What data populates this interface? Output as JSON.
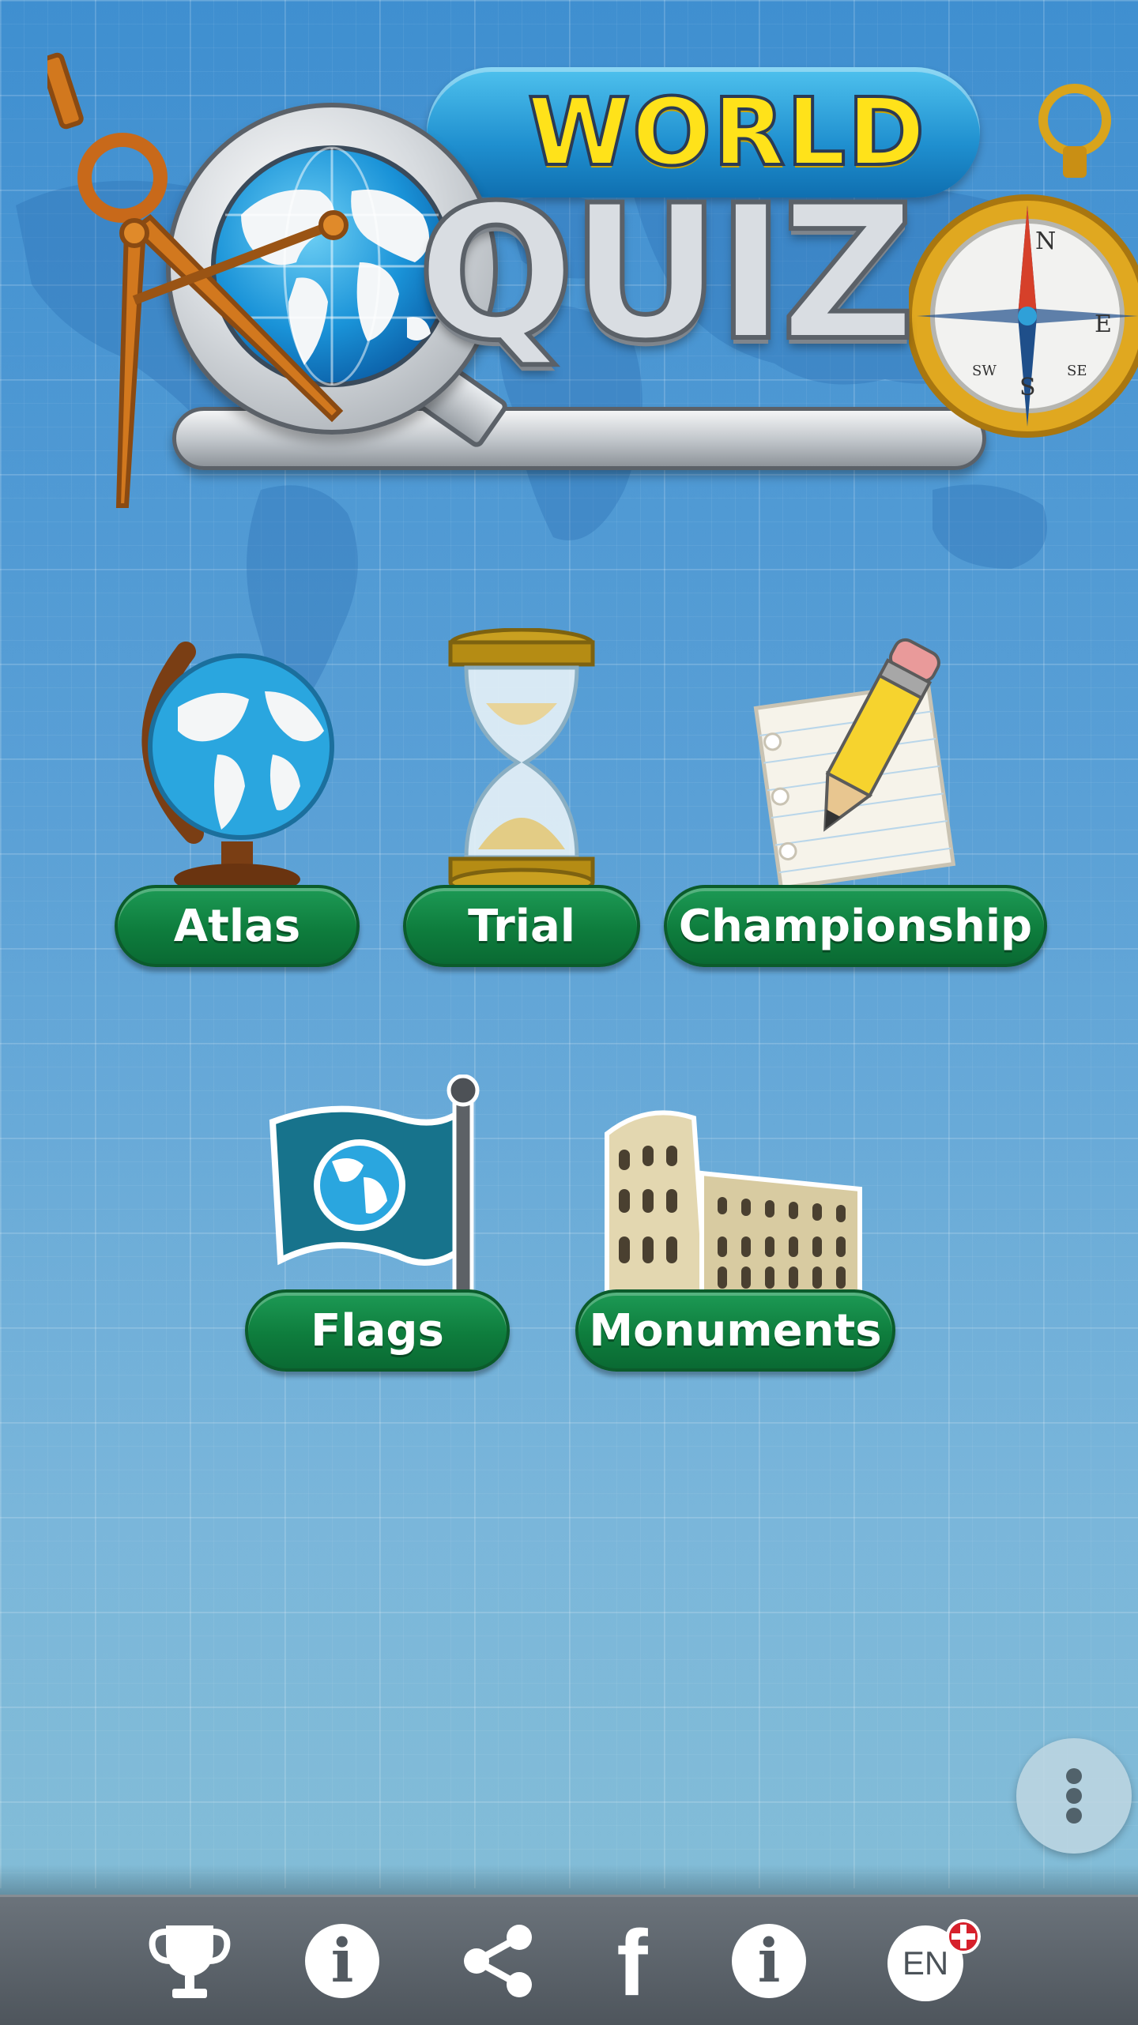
{
  "logo": {
    "top_word": "WORLD",
    "main_word": "QUIZ",
    "compass_letters": {
      "n": "N",
      "e": "E",
      "s": "S",
      "se": "SE",
      "sw": "SW"
    }
  },
  "menu": {
    "atlas": {
      "label": "Atlas",
      "icon": "globe-icon"
    },
    "trial": {
      "label": "Trial",
      "icon": "hourglass-icon"
    },
    "championship": {
      "label": "Championship",
      "icon": "pencil-paper-icon"
    },
    "flags": {
      "label": "Flags",
      "icon": "flag-icon"
    },
    "monuments": {
      "label": "Monuments",
      "icon": "colosseum-icon"
    }
  },
  "fab": {
    "icon": "more-vert-icon"
  },
  "bottom_bar": {
    "items": [
      {
        "icon": "trophy-icon"
      },
      {
        "icon": "info-icon",
        "glyph": "i"
      },
      {
        "icon": "share-icon"
      },
      {
        "icon": "facebook-icon",
        "glyph": "f"
      },
      {
        "icon": "info-icon",
        "glyph": "i"
      },
      {
        "icon": "language-icon",
        "label": "EN"
      }
    ]
  },
  "colors": {
    "background": "#5aa0d6",
    "button_green": "#0e7d3d",
    "bottom_bar": "#565d64",
    "logo_yellow": "#ffe21a"
  }
}
